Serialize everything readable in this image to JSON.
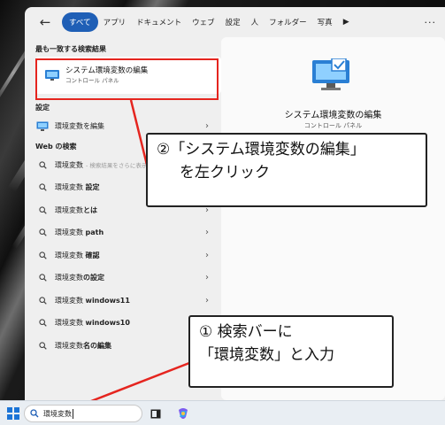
{
  "tabs": [
    {
      "label": "すべて",
      "active": true
    },
    {
      "label": "アプリ"
    },
    {
      "label": "ドキュメント"
    },
    {
      "label": "ウェブ"
    },
    {
      "label": "設定"
    },
    {
      "label": "人"
    },
    {
      "label": "フォルダー"
    },
    {
      "label": "写真"
    }
  ],
  "best_match": {
    "header": "最も一致する検索結果",
    "title": "システム環境変数の編集",
    "subtitle": "コントロール パネル",
    "icon": "system-properties-icon"
  },
  "settings": {
    "header": "設定",
    "item": "環境変数を編集",
    "icon": "system-properties-icon"
  },
  "web": {
    "header": "Web の検索",
    "first": {
      "prefix": "環境変数",
      "hint": "- 検索結果をさらに表示"
    },
    "items": [
      {
        "plain": "環境変数 ",
        "bold": "設定"
      },
      {
        "plain": "環境変数",
        "bold": "とは"
      },
      {
        "plain": "環境変数 ",
        "bold": "path"
      },
      {
        "plain": "環境変数 ",
        "bold": "確認"
      },
      {
        "plain": "環境変数",
        "bold": "の設定"
      },
      {
        "plain": "環境変数 ",
        "bold": "windows11"
      },
      {
        "plain": "環境変数 ",
        "bold": "windows10"
      },
      {
        "plain": "環境変数",
        "bold": "名の編集"
      }
    ]
  },
  "detail": {
    "title": "システム環境変数の編集",
    "subtitle": "コントロール パネル"
  },
  "callouts": {
    "step2_line1": "②「システム環境変数の編集」",
    "step2_line2": "を左クリック",
    "step1_line1": "① 検索バーに",
    "step1_line2": "「環境変数」と入力"
  },
  "taskbar": {
    "search_value": "環境変数"
  },
  "colors": {
    "accent": "#1f5fb6",
    "highlight": "#e5251f"
  }
}
